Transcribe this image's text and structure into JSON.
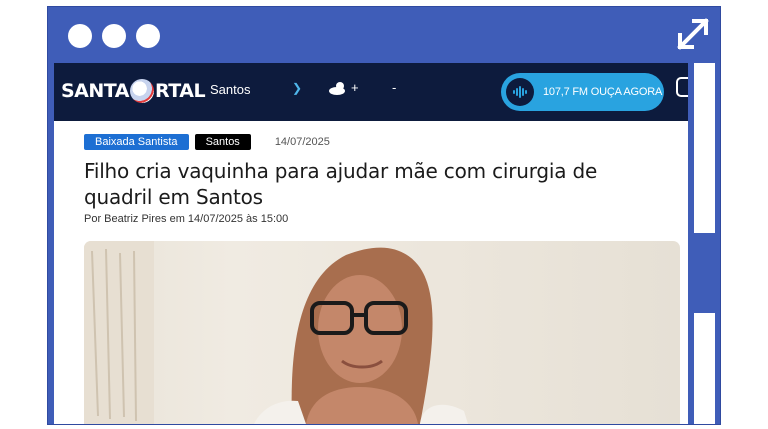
{
  "site": {
    "logo_text_left": "SANTA",
    "logo_text_right": "RTAL",
    "city": "Santos",
    "weather_plus": "+",
    "weather_minus": "-",
    "radio_label": "107,7 FM OUÇA AGORA"
  },
  "article": {
    "tag_primary": "Baixada Santista",
    "tag_secondary": "Santos",
    "date": "14/07/2025",
    "headline": "Filho cria vaquinha para ajudar mãe com cirurgia de quadril em Santos",
    "byline": "Por Beatriz Pires em 14/07/2025 às 15:00"
  },
  "colors": {
    "frame": "#3f5db8",
    "topbar": "#0d1b3d",
    "radio_button": "#29a3e0",
    "tag_primary": "#1d6fd3",
    "tag_secondary": "#000000"
  },
  "icons": [
    "window-dot-icon",
    "expand-icon",
    "chevron-down-icon",
    "weather-cloud-icon",
    "radio-wave-icon",
    "instagram-icon"
  ]
}
